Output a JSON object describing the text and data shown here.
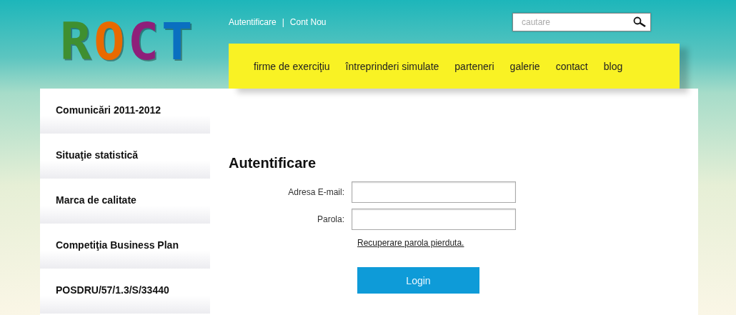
{
  "logo": {
    "text": "ROCT"
  },
  "top_links": [
    {
      "label": "Autentificare"
    },
    {
      "label": "Cont Nou"
    }
  ],
  "top_links_separator": "|",
  "search": {
    "placeholder": "cautare"
  },
  "nav": [
    {
      "label": "firme de exerciţiu"
    },
    {
      "label": "întreprinderi simulate"
    },
    {
      "label": "parteneri"
    },
    {
      "label": "galerie"
    },
    {
      "label": "contact"
    },
    {
      "label": "blog"
    }
  ],
  "sidebar": {
    "items": [
      {
        "label": "Comunicări 2011-2012"
      },
      {
        "label": "Situaţie statistică"
      },
      {
        "label": "Marca de calitate"
      },
      {
        "label": "Competiţia Business Plan"
      },
      {
        "label": "POSDRU/57/1.3/S/33440"
      }
    ]
  },
  "login": {
    "title": "Autentificare",
    "fields": [
      {
        "label": "Adresa E-mail:"
      },
      {
        "label": "Parola:"
      }
    ],
    "recover_link": "Recuperare parola pierduta.",
    "button": "Login"
  }
}
